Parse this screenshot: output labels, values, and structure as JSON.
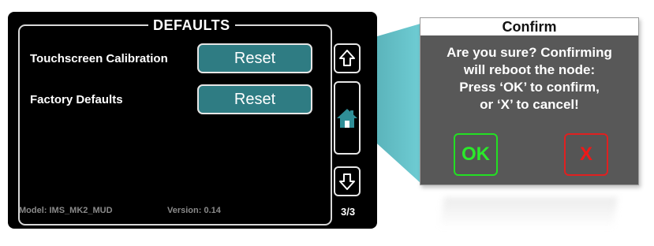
{
  "panel": {
    "title": "DEFAULTS",
    "rows": [
      {
        "label": "Touchscreen Calibration",
        "button": "Reset"
      },
      {
        "label": "Factory Defaults",
        "button": "Reset"
      }
    ],
    "nav": {
      "up_icon": "arrow-up-outline",
      "home_icon": "home",
      "down_icon": "arrow-down-outline"
    },
    "footer": {
      "model": "Model: IMS_MK2_MUD",
      "version": "Version: 0.14",
      "page": "3/3"
    }
  },
  "dialog": {
    "title": "Confirm",
    "message": [
      "Are you sure? Confirming",
      "will reboot the node:",
      "Press ‘OK’ to confirm,",
      "or ‘X’ to cancel!"
    ],
    "ok_label": "OK",
    "cancel_label": "X"
  },
  "colors": {
    "screen_bg": "#000000",
    "button_teal": "#2f7c83",
    "connector_cyan": "#3aa8b0",
    "dialog_bg": "#585858",
    "ok_green": "#23e023",
    "cancel_red": "#e02020"
  }
}
